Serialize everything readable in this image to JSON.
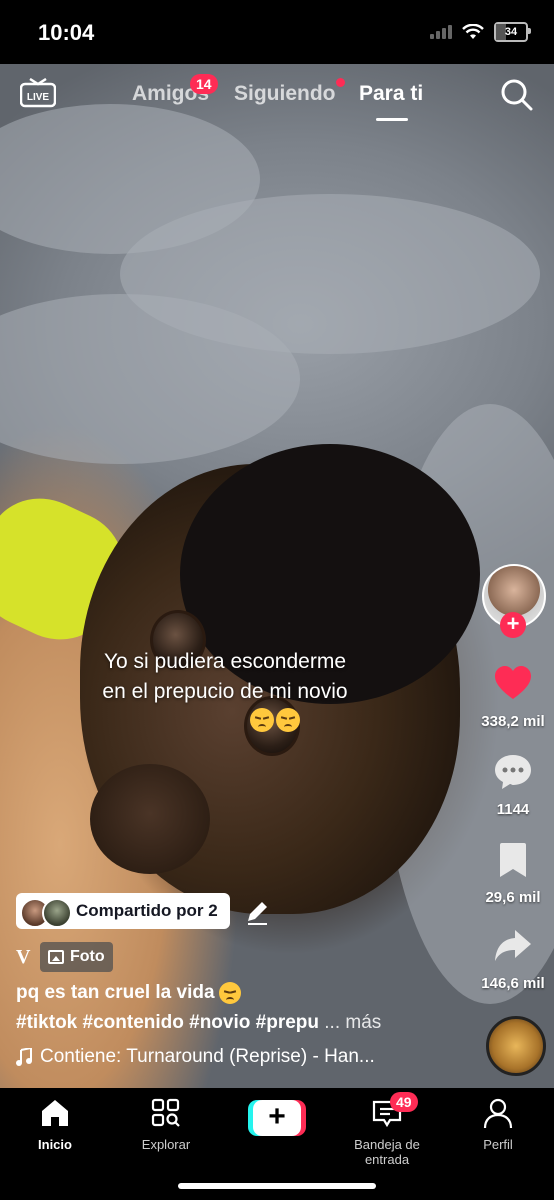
{
  "status_bar": {
    "time": "10:04",
    "battery_level": "34"
  },
  "top_nav": {
    "tabs": [
      {
        "label": "Amigos",
        "badge": "14"
      },
      {
        "label": "Siguiendo",
        "has_dot": true
      },
      {
        "label": "Para ti",
        "active": true
      }
    ]
  },
  "video": {
    "overlay_text_line1": "Yo si pudiera esconderme",
    "overlay_text_line2": "en el prepucio de mi novio"
  },
  "right_rail": {
    "likes": "338,2 mil",
    "comments": "1144",
    "saves": "29,6 mil",
    "shares": "146,6 mil"
  },
  "post": {
    "shared_label": "Compartido por 2",
    "v_mark": "V",
    "type_chip": "Foto",
    "caption": "pq es tan cruel la vida",
    "hashtags": "#tiktok #contenido #novio #prepu",
    "more_label": "... más",
    "music": "Contiene: Turnaround (Reprise) - Han..."
  },
  "tab_bar": {
    "items": [
      {
        "label": "Inicio",
        "active": true
      },
      {
        "label": "Explorar"
      },
      {
        "label": "Bandeja de entrada",
        "badge": "49"
      },
      {
        "label": "Perfil"
      }
    ],
    "create_label": "+"
  },
  "colors": {
    "accent": "#fe2c55",
    "cyan": "#25f4ee"
  }
}
